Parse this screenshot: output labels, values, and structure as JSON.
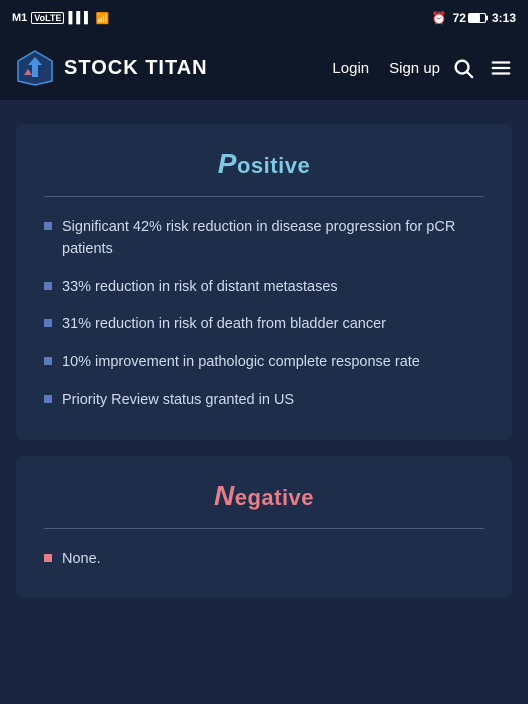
{
  "statusBar": {
    "carrier": "M1",
    "carrierType": "VoLTE",
    "signalBars": "signal",
    "wifi": "wifi",
    "alarm": "alarm",
    "battery": "72",
    "time": "3:13"
  },
  "navbar": {
    "logoText": "STOCK TITAN",
    "loginLabel": "Login",
    "signupLabel": "Sign up"
  },
  "positive": {
    "title": "Positive",
    "titleCap": "P",
    "titleRest": "ositive",
    "bullets": [
      "Significant 42% risk reduction in disease progression for pCR patients",
      "33% reduction in risk of distant metastases",
      "31% reduction in risk of death from bladder cancer",
      "10% improvement in pathologic complete response rate",
      "Priority Review status granted in US"
    ]
  },
  "negative": {
    "title": "Negative",
    "titleCap": "N",
    "titleRest": "egative",
    "bullets": [
      "None."
    ]
  }
}
